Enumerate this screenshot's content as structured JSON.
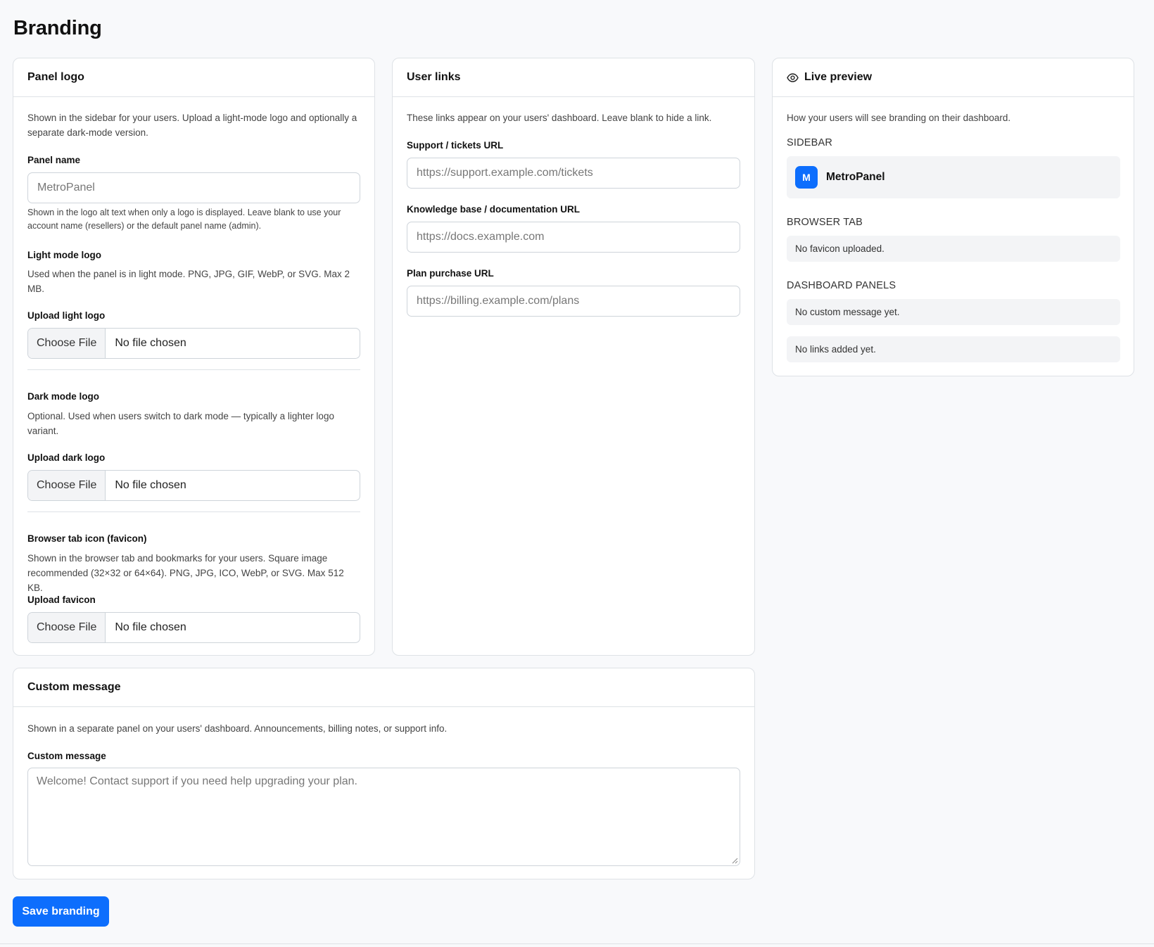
{
  "page": {
    "title": "Branding"
  },
  "panel_logo": {
    "title": "Panel logo",
    "description": "Shown in the sidebar for your users. Upload a light-mode logo and optionally a separate dark-mode version.",
    "panel_name": {
      "label": "Panel name",
      "placeholder": "MetroPanel",
      "help": "Shown in the logo alt text when only a logo is displayed. Leave blank to use your account name (resellers) or the default panel name (admin)."
    },
    "light_logo": {
      "title": "Light mode logo",
      "description": "Used when the panel is in light mode. PNG, JPG, GIF, WebP, or SVG. Max 2 MB.",
      "upload_label": "Upload light logo",
      "choose_label": "Choose File",
      "status": "No file chosen"
    },
    "dark_logo": {
      "title": "Dark mode logo",
      "description": "Optional. Used when users switch to dark mode — typically a lighter logo variant.",
      "upload_label": "Upload dark logo",
      "choose_label": "Choose File",
      "status": "No file chosen"
    },
    "favicon": {
      "title": "Browser tab icon (favicon)",
      "description": "Shown in the browser tab and bookmarks for your users. Square image recommended (32×32 or 64×64). PNG, JPG, ICO, WebP, or SVG. Max 512 KB.",
      "upload_label": "Upload favicon",
      "choose_label": "Choose File",
      "status": "No file chosen"
    }
  },
  "user_links": {
    "title": "User links",
    "description": "These links appear on your users' dashboard. Leave blank to hide a link.",
    "support": {
      "label": "Support / tickets URL",
      "placeholder": "https://support.example.com/tickets"
    },
    "docs": {
      "label": "Knowledge base / documentation URL",
      "placeholder": "https://docs.example.com"
    },
    "plans": {
      "label": "Plan purchase URL",
      "placeholder": "https://billing.example.com/plans"
    }
  },
  "live_preview": {
    "title": "Live preview",
    "icon": "eye-icon",
    "description": "How your users will see branding on their dashboard.",
    "sidebar_title": "SIDEBAR",
    "logo_letter": "M",
    "panel_name": "MetroPanel",
    "browser_tab_title": "BROWSER TAB",
    "favicon_status": "No favicon uploaded.",
    "dashboard_panels_title": "DASHBOARD PANELS",
    "message_status": "No custom message yet.",
    "links_status": "No links added yet.",
    "accent_color": "#0d6efd"
  },
  "custom_message": {
    "title": "Custom message",
    "description": "Shown in a separate panel on your users' dashboard. Announcements, billing notes, or support info.",
    "label": "Custom message",
    "placeholder": "Welcome! Contact support if you need help upgrading your plan."
  },
  "save_label": "Save branding"
}
